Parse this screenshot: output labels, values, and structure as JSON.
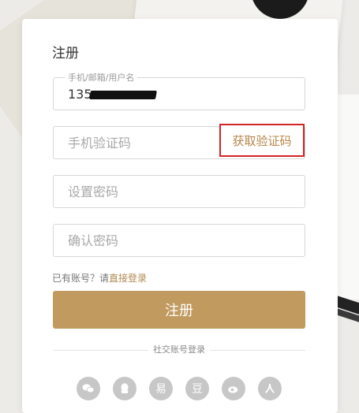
{
  "form": {
    "title": "注册",
    "account_label": "手机/邮箱/用户名",
    "account_value": "135",
    "sms_placeholder": "手机验证码",
    "get_code_label": "获取验证码",
    "password_placeholder": "设置密码",
    "confirm_placeholder": "确认密码",
    "have_account_text": "已有账号？请",
    "login_link": "直接登录",
    "submit_label": "注册"
  },
  "social": {
    "title": "社交账号登录",
    "icons": [
      "wechat-icon",
      "qq-icon",
      "yixin-icon",
      "douban-icon",
      "weibo-icon",
      "renren-icon"
    ],
    "glyph_yixin": "易",
    "glyph_douban": "豆"
  },
  "colors": {
    "accent": "#c09a5e",
    "link": "#b08a52",
    "highlight_border": "#d12525"
  }
}
